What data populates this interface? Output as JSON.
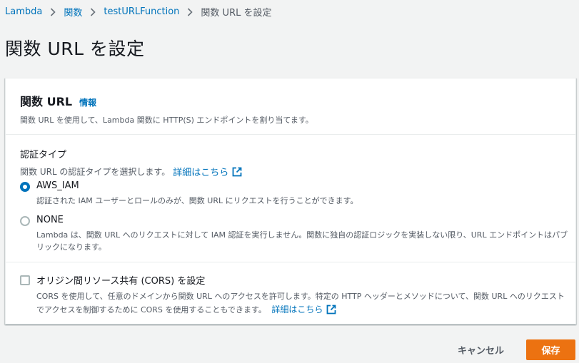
{
  "breadcrumb": {
    "items": [
      "Lambda",
      "関数",
      "testURLFunction"
    ],
    "current": "関数 URL を設定"
  },
  "page_title": "関数 URL を設定",
  "panel": {
    "title": "関数 URL",
    "info": "情報",
    "description": "関数 URL を使用して、Lambda 関数に HTTP(S) エンドポイントを割り当てます。"
  },
  "auth": {
    "label": "認証タイプ",
    "description": "関数 URL の認証タイプを選択します。",
    "detail_link": "詳細はこちら",
    "selected": "AWS_IAM",
    "options": [
      {
        "label": "AWS_IAM",
        "description": "認証された IAM ユーザーとロールのみが、関数 URL にリクエストを行うことができます。"
      },
      {
        "label": "NONE",
        "description": "Lambda は、関数 URL へのリクエストに対して IAM 認証を実行しません。関数に独自の認証ロジックを実装しない限り、URL エンドポイントはパブリックになります。"
      }
    ]
  },
  "cors": {
    "label": "オリジン間リソース共有 (CORS) を設定",
    "checked": false,
    "description": "CORS を使用して、任意のドメインから関数 URL へのアクセスを許可します。特定の HTTP ヘッダーとメソッドについて、関数 URL へのリクエストでアクセスを制御するために CORS を使用することもできます。",
    "detail_link": "詳細はこちら"
  },
  "footer": {
    "cancel_label": "キャンセル",
    "save_label": "保存"
  },
  "colors": {
    "link": "#0073bb",
    "primary_button": "#ec7211",
    "background": "#f2f3f3"
  }
}
